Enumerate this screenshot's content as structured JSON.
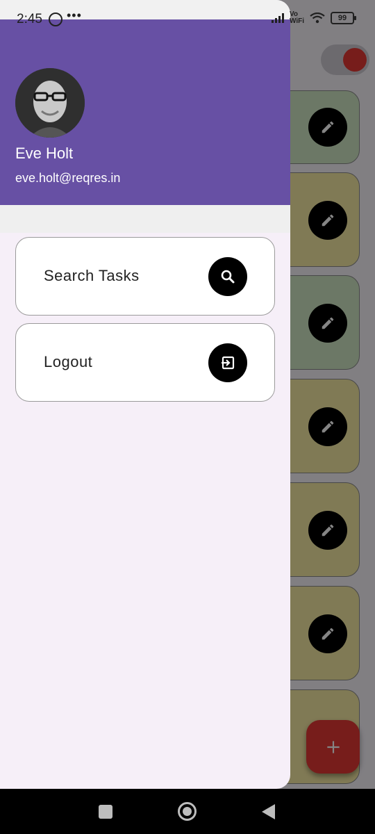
{
  "status_bar": {
    "time": "2:45",
    "dots": "•••",
    "network_label_top": "Vo",
    "network_label_bottom": "WiFi",
    "battery": "99"
  },
  "drawer": {
    "user": {
      "name": "Eve Holt",
      "email": "eve.holt@reqres.in"
    },
    "items": [
      {
        "label": "Search Tasks",
        "icon": "search-icon"
      },
      {
        "label": "Logout",
        "icon": "logout-icon"
      }
    ]
  },
  "background": {
    "fab_icon": "add-icon",
    "card_colors": [
      "#cfe6c4",
      "#f6eaa4",
      "#cfe6c4",
      "#f6eaa4",
      "#f6eaa4",
      "#f6eaa4",
      "#f6eaa4"
    ],
    "accent": "#6750a4",
    "toggle_color": "#e53935"
  },
  "nav_bar": {
    "icons": [
      "recents-icon",
      "home-icon",
      "back-icon"
    ]
  }
}
